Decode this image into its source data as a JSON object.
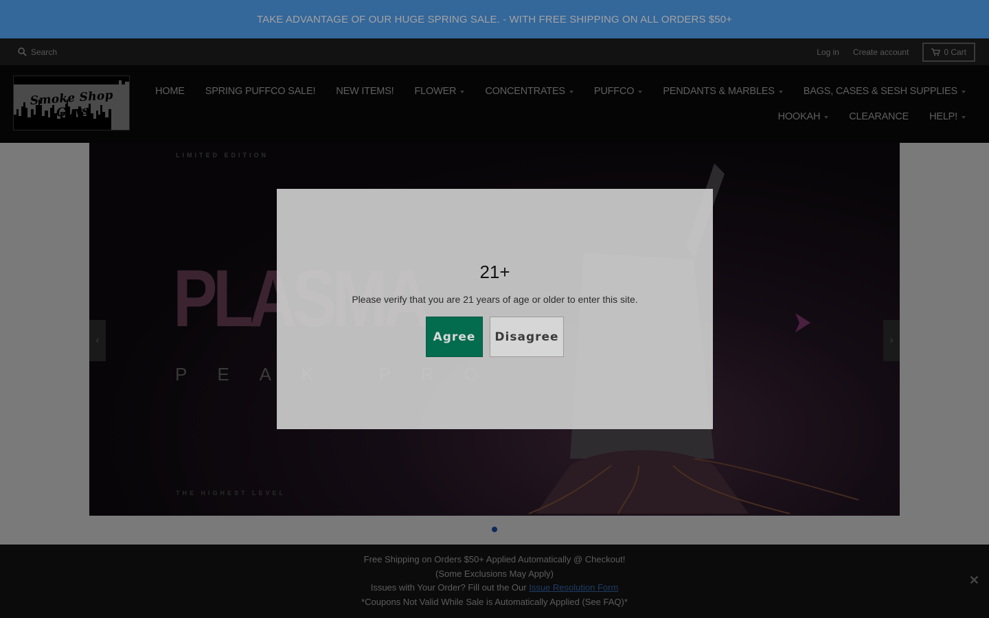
{
  "announcement": {
    "text": "TAKE ADVANTAGE OF OUR HUGE SPRING SALE. - WITH FREE SHIPPING ON ALL ORDERS $50+"
  },
  "utility": {
    "search_label": "Search",
    "login": "Log in",
    "create_account": "Create account",
    "cart_label": "0 Cart"
  },
  "logo": {
    "text": "Smoke Shop Guys"
  },
  "nav": {
    "row1": [
      {
        "label": "HOME",
        "dropdown": false
      },
      {
        "label": "SPRING PUFFCO SALE!",
        "dropdown": false
      },
      {
        "label": "NEW ITEMS!",
        "dropdown": false
      },
      {
        "label": "FLOWER",
        "dropdown": true
      },
      {
        "label": "CONCENTRATES",
        "dropdown": true
      },
      {
        "label": "PUFFCO",
        "dropdown": true
      },
      {
        "label": "PENDANTS & MARBLES",
        "dropdown": true
      },
      {
        "label": "BAGS, CASES & SESH SUPPLIES",
        "dropdown": true
      }
    ],
    "row2": [
      {
        "label": "HOOKAH",
        "dropdown": true
      },
      {
        "label": "CLEARANCE",
        "dropdown": false
      },
      {
        "label": "HELP!",
        "dropdown": true
      }
    ]
  },
  "slide": {
    "top_caption": "LIMITED EDITION",
    "title": "PLASMA",
    "subtitle": "PEAK PRO",
    "bottom_caption": "THE HIGHEST LEVEL",
    "prev_icon": "chevron-left-icon",
    "next_icon": "chevron-right-icon",
    "slide_count": 1,
    "active_slide": 1
  },
  "notice": {
    "line1": "Free Shipping on Orders $50+ Applied Automatically @ Checkout!",
    "line2": "(Some Exclusions May Apply)",
    "line3_prefix": "Issues with Your Order? Fill out the Our ",
    "line3_link": "Issue Resolution Form",
    "line4": "*Coupons Not Valid While Sale is Automatically Applied (See FAQ)*"
  },
  "modal": {
    "title": "21+",
    "message": "Please verify that you are 21 years of age or older to enter this site.",
    "agree_label": "Agree",
    "disagree_label": "Disagree"
  },
  "colors": {
    "announcement_bg": "#34679a",
    "agree_button": "#036b4e",
    "modal_bg": "#cccccc"
  }
}
